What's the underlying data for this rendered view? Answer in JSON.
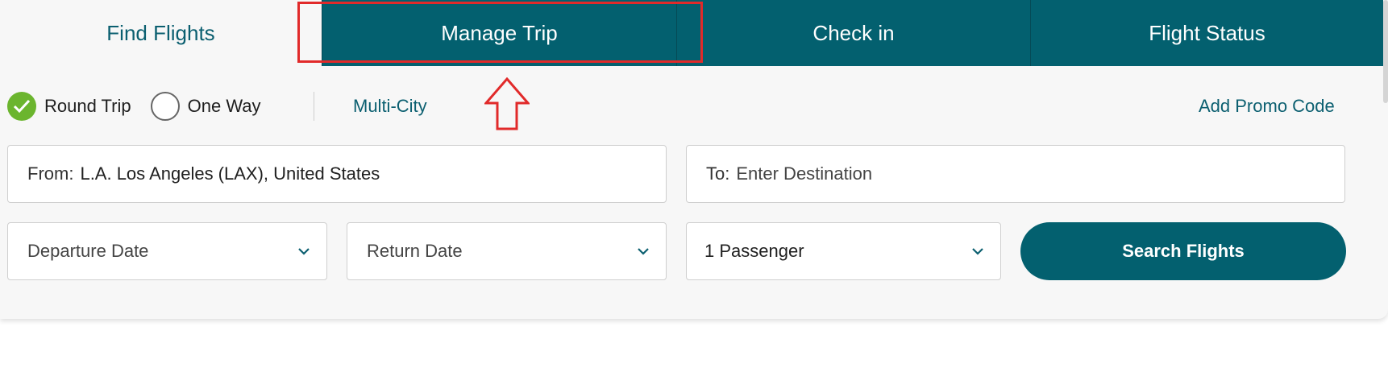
{
  "tabs": [
    {
      "label": "Find Flights"
    },
    {
      "label": "Manage Trip"
    },
    {
      "label": "Check in"
    },
    {
      "label": "Flight Status"
    }
  ],
  "trip_type": {
    "round_trip": "Round Trip",
    "one_way": "One Way",
    "multi_city": "Multi-City",
    "selected": "Round Trip"
  },
  "promo": {
    "label": "Add Promo Code"
  },
  "from": {
    "label": "From:",
    "value": "L.A. Los Angeles (LAX), United States"
  },
  "to": {
    "label": "To:",
    "placeholder": "Enter Destination"
  },
  "departure": {
    "placeholder": "Departure Date"
  },
  "return": {
    "placeholder": "Return Date"
  },
  "passengers": {
    "value": "1 Passenger"
  },
  "search": {
    "label": "Search Flights"
  },
  "colors": {
    "brand": "#03606f",
    "check": "#6bb52e",
    "annotation": "#e12a2a"
  }
}
